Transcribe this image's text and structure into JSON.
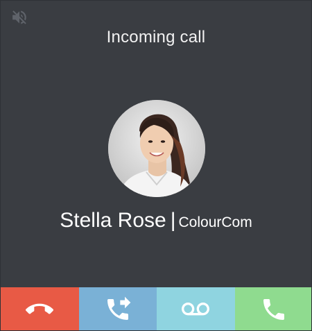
{
  "header": {
    "title": "Incoming call",
    "mute_icon": "speaker-muted-icon",
    "mute_color": "#5f636a"
  },
  "caller": {
    "name": "Stella Rose",
    "separator": "|",
    "company": "ColourCom",
    "avatar": "caller-photo"
  },
  "actions": [
    {
      "id": "decline",
      "icon": "hang-up-icon",
      "color": "#e85a45"
    },
    {
      "id": "transfer",
      "icon": "call-transfer-icon",
      "color": "#7ab1d6"
    },
    {
      "id": "voicemail",
      "icon": "voicemail-icon",
      "color": "#8fd4e0"
    },
    {
      "id": "answer",
      "icon": "phone-icon",
      "color": "#8fdb8f"
    }
  ],
  "colors": {
    "background": "#3a3d42",
    "text": "#ffffff"
  }
}
